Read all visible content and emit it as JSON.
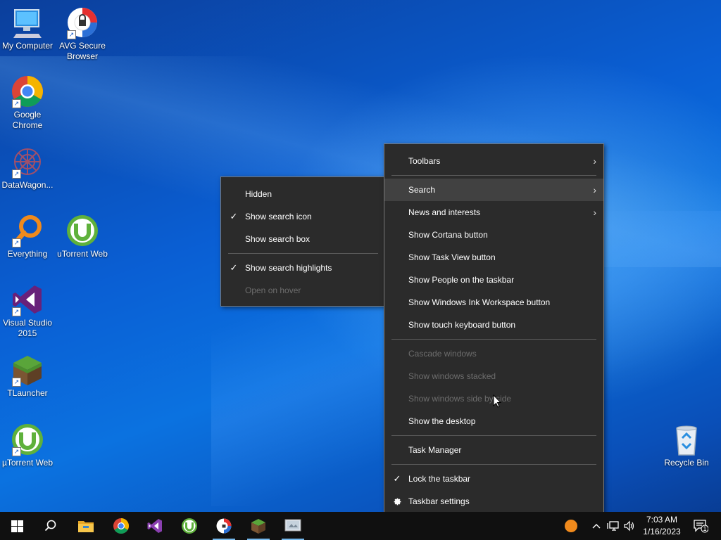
{
  "desktop": {
    "icons": [
      {
        "label": "My Computer"
      },
      {
        "label": "AVG Secure Browser"
      },
      {
        "label": "Google Chrome"
      },
      {
        "label": "DataWagon..."
      },
      {
        "label": "Everything"
      },
      {
        "label": "uTorrent Web"
      },
      {
        "label": "Visual Studio 2015"
      },
      {
        "label": "TLauncher"
      },
      {
        "label": "µTorrent Web"
      },
      {
        "label": "Recycle Bin"
      }
    ]
  },
  "search_submenu": {
    "items": [
      {
        "label": "Hidden",
        "checked": false,
        "disabled": false
      },
      {
        "label": "Show search icon",
        "checked": true,
        "disabled": false
      },
      {
        "label": "Show search box",
        "checked": false,
        "disabled": false
      },
      {
        "label": "Show search highlights",
        "checked": true,
        "disabled": false
      },
      {
        "label": "Open on hover",
        "checked": false,
        "disabled": true
      }
    ]
  },
  "taskbar_menu": {
    "items": [
      {
        "label": "Toolbars",
        "submenu": true
      },
      {
        "label": "Search",
        "submenu": true,
        "highlighted": true
      },
      {
        "label": "News and interests",
        "submenu": true
      },
      {
        "label": "Show Cortana button"
      },
      {
        "label": "Show Task View button"
      },
      {
        "label": "Show People on the taskbar"
      },
      {
        "label": "Show Windows Ink Workspace button"
      },
      {
        "label": "Show touch keyboard button"
      },
      {
        "label": "Cascade windows",
        "disabled": true
      },
      {
        "label": "Show windows stacked",
        "disabled": true
      },
      {
        "label": "Show windows side by side",
        "disabled": true
      },
      {
        "label": "Show the desktop"
      },
      {
        "label": "Task Manager"
      },
      {
        "label": "Lock the taskbar",
        "checked": true
      },
      {
        "label": "Taskbar settings",
        "icon": "gear-icon"
      }
    ],
    "check_glyph": "✓",
    "arrow_glyph": "›"
  },
  "taskbar": {
    "pinned": [
      "start-icon",
      "search-icon",
      "file-explorer-icon",
      "chrome-icon",
      "visual-studio-icon",
      "utorrent-icon",
      "avg-browser-icon",
      "minecraft-icon",
      "app-icon"
    ],
    "clock_time": "7:03 AM",
    "clock_date": "1/16/2023",
    "notification_count": "1"
  },
  "colors": {
    "menu_bg": "#2b2b2b",
    "menu_highlight": "#414141",
    "taskbar_bg": "#101010",
    "accent": "#76b9ed"
  }
}
